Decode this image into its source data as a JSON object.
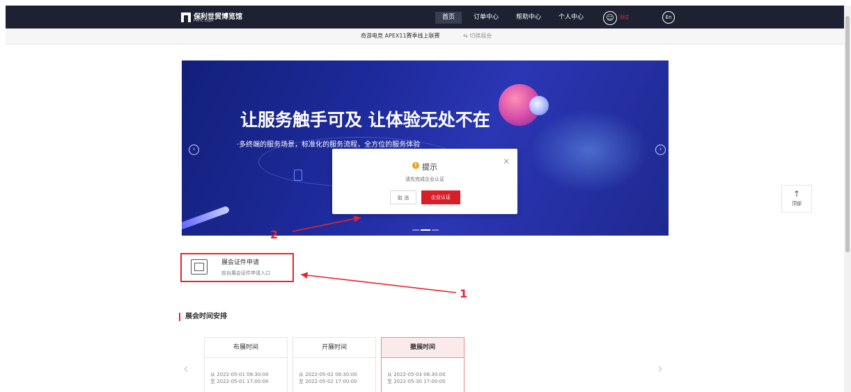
{
  "header": {
    "logo_cn": "保利世贸博览馆",
    "logo_en": "PWTC Expo",
    "nav": [
      "首页",
      "订单中心",
      "帮助中心",
      "个人中心"
    ],
    "user_name": "测试",
    "lang": "En"
  },
  "subbar": {
    "event_name": "奇游电竞 APEX11赛季线上联赛",
    "switch_label": "⇆ 切换展会"
  },
  "banner": {
    "title": "让服务触手可及 让体验无处不在",
    "subtitle": "·多终端的服务场景，标准化的服务流程，全方位的服务体验"
  },
  "modal": {
    "title": "提示",
    "message": "请先完成企业认证",
    "cancel_label": "取 消",
    "confirm_label": "企业认证",
    "close_glyph": "×"
  },
  "entry": {
    "title": "展会证件申请",
    "desc": "前台展会证件申请入口"
  },
  "annotations": [
    "1",
    "2"
  ],
  "schedule": {
    "section_title": "展会时间安排",
    "columns": [
      {
        "label": "布展时间",
        "from": "从 2022-05-01 08:30:00",
        "to": "至 2022-05-01 17:00:00",
        "active": false
      },
      {
        "label": "开展时间",
        "from": "从 2022-05-02 08:30:00",
        "to": "至 2022-05-02 17:00:00",
        "active": false
      },
      {
        "label": "撤展时间",
        "from": "从 2022-05-03 08:30:00",
        "to": "至 2022-05-30 17:00:00",
        "active": true
      }
    ]
  },
  "back_to_top": {
    "arrow": "↑",
    "label": "顶部"
  },
  "colors": {
    "header_bg": "#1d2132",
    "accent_red": "#d71f28",
    "annotation_red": "#e8232f"
  }
}
